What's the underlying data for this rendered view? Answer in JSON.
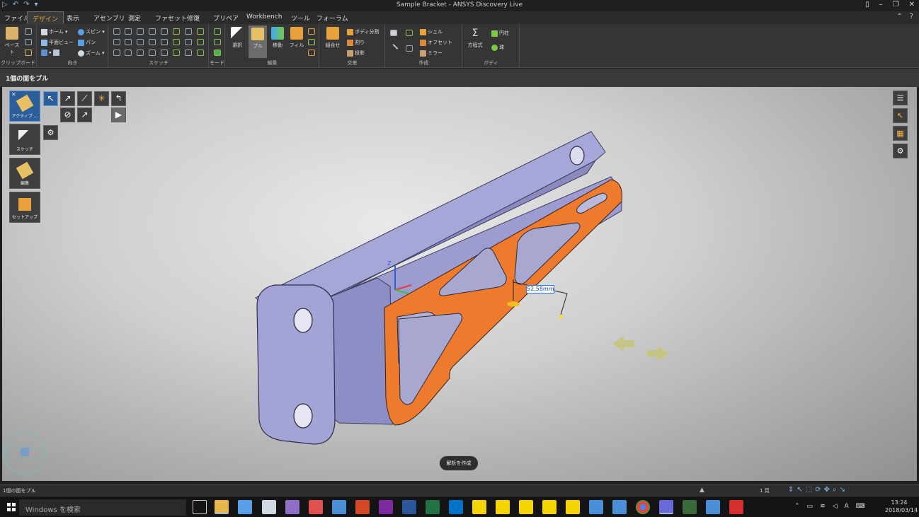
{
  "window": {
    "title": "Sample Bracket - ANSYS Discovery Live"
  },
  "menu": {
    "tabs": [
      "ファイル",
      "デザイン",
      "表示",
      "アセンブリ",
      "測定",
      "ファセット",
      "修復",
      "プリペア",
      "Workbench",
      "ツール",
      "フォーラム"
    ],
    "active": "デザイン"
  },
  "ribbon": {
    "clipboard": {
      "paste": "ペースト",
      "group": "クリップボード"
    },
    "orient": {
      "home": "ホーム",
      "plan_view": "平面ビュー",
      "spin": "スピン",
      "pan": "パン",
      "zoom": "ズーム",
      "group": "向き"
    },
    "sketch": {
      "group": "スケッチ"
    },
    "mode": {
      "group": "モード"
    },
    "edit": {
      "select": "選択",
      "pull": "プル",
      "move": "移動",
      "fill": "フィル",
      "group": "編集"
    },
    "intersect": {
      "combine": "組合せ",
      "split_body": "ボディ分割",
      "split": "割り",
      "project": "投影",
      "group": "交差"
    },
    "create": {
      "shell": "シェル",
      "offset": "オフセット",
      "mirror": "ミラー",
      "group": "作成"
    },
    "body": {
      "equation": "方程式",
      "cylinder": "円柱",
      "sphere": "球",
      "group": "ボディ"
    }
  },
  "panel": {
    "title": "1個の面をプル"
  },
  "tools": {
    "active": "アクティブ ...",
    "sketch": "スケッチ",
    "edit": "編集",
    "setup": "セットアップ"
  },
  "viewport": {
    "dimension": "52.58mm",
    "create_analysis": "解析を作成"
  },
  "status": {
    "text": "1個の面をプル",
    "page": "1 頁"
  },
  "taskbar": {
    "search_placeholder": "Windows を検索",
    "time": "13:24",
    "date": "2018/03/14",
    "ime": "A"
  },
  "colors": {
    "selected_face": "#ee7a2e",
    "body": "#9f9fd4",
    "accent": "#2c5f9a"
  }
}
